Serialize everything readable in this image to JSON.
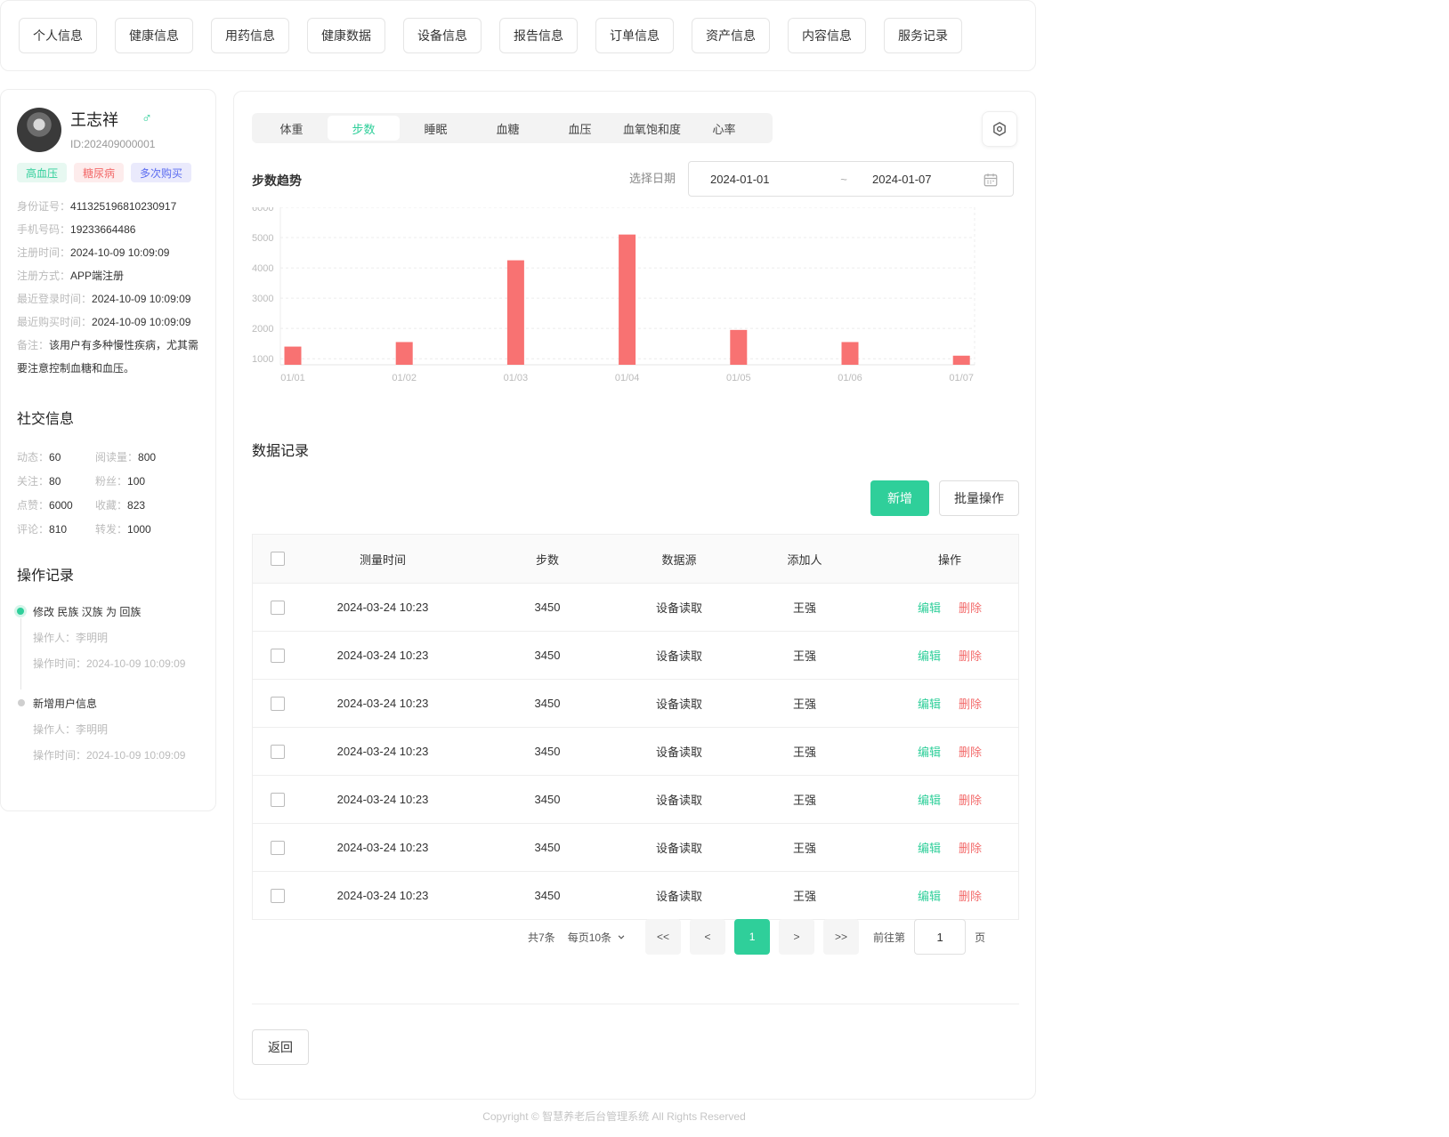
{
  "topnav": [
    "个人信息",
    "健康信息",
    "用药信息",
    "健康数据",
    "设备信息",
    "报告信息",
    "订单信息",
    "资产信息",
    "内容信息",
    "服务记录"
  ],
  "profile": {
    "name": "王志祥",
    "gender_symbol": "♂",
    "id": "ID:202409000001",
    "tags": [
      "高血压",
      "糖尿病",
      "多次购买"
    ],
    "info": [
      {
        "label": "身份证号：",
        "value": "411325196810230917"
      },
      {
        "label": "手机号码：",
        "value": "19233664486"
      },
      {
        "label": "注册时间：",
        "value": "2024-10-09 10:09:09"
      },
      {
        "label": "注册方式：",
        "value": "APP端注册"
      },
      {
        "label": "最近登录时间：",
        "value": "2024-10-09 10:09:09"
      },
      {
        "label": "最近购买时间：",
        "value": "2024-10-09 10:09:09"
      }
    ],
    "note_label": "备注：",
    "note": "该用户有多种慢性疾病，尤其需要注意控制血糖和血压。"
  },
  "social": {
    "title": "社交信息",
    "items": [
      {
        "label": "动态：",
        "value": "60"
      },
      {
        "label": "阅读量：",
        "value": "800"
      },
      {
        "label": "关注：",
        "value": "80"
      },
      {
        "label": "粉丝：",
        "value": "100"
      },
      {
        "label": "点赞：",
        "value": "6000"
      },
      {
        "label": "收藏：",
        "value": "823"
      },
      {
        "label": "评论：",
        "value": "810"
      },
      {
        "label": "转发：",
        "value": "1000"
      }
    ]
  },
  "ops": {
    "title": "操作记录",
    "items": [
      {
        "title": "修改 民族 汉族 为 回族",
        "operator": "操作人：李明明",
        "time": "操作时间：2024-10-09 10:09:09"
      },
      {
        "title": "新增用户信息",
        "operator": "操作人：李明明",
        "time": "操作时间：2024-10-09 10:09:09"
      }
    ]
  },
  "tabs": {
    "items": [
      "体重",
      "步数",
      "睡眠",
      "血糖",
      "血压",
      "血氧饱和度",
      "心率"
    ],
    "active": 1
  },
  "chart_section": {
    "title": "步数趋势",
    "date_label": "选择日期",
    "date_start": "2024-01-01",
    "date_sep": "~",
    "date_end": "2024-01-07"
  },
  "chart_data": {
    "type": "bar",
    "categories": [
      "01/01",
      "01/02",
      "01/03",
      "01/04",
      "01/05",
      "01/06",
      "01/07"
    ],
    "values": [
      1400,
      1550,
      4250,
      5100,
      1950,
      1550,
      1100
    ],
    "ylim": [
      800,
      6000
    ],
    "yticks": [
      1000,
      2000,
      3000,
      4000,
      5000,
      6000
    ],
    "color": "#f87272",
    "grid": true
  },
  "records": {
    "title": "数据记录",
    "add_label": "新增",
    "batch_label": "批量操作",
    "columns": [
      "测量时间",
      "步数",
      "数据源",
      "添加人",
      "操作"
    ],
    "edit_label": "编辑",
    "delete_label": "删除",
    "rows": [
      [
        "2024-03-24 10:23",
        "3450",
        "设备读取",
        "王强"
      ],
      [
        "2024-03-24 10:23",
        "3450",
        "设备读取",
        "王强"
      ],
      [
        "2024-03-24 10:23",
        "3450",
        "设备读取",
        "王强"
      ],
      [
        "2024-03-24 10:23",
        "3450",
        "设备读取",
        "王强"
      ],
      [
        "2024-03-24 10:23",
        "3450",
        "设备读取",
        "王强"
      ],
      [
        "2024-03-24 10:23",
        "3450",
        "设备读取",
        "王强"
      ],
      [
        "2024-03-24 10:23",
        "3450",
        "设备读取",
        "王强"
      ]
    ]
  },
  "pager": {
    "total": "共7条",
    "page_size": "每页10条",
    "first": "<<",
    "prev": "<",
    "current": "1",
    "next": ">",
    "last": ">>",
    "goto_label": "前往第",
    "goto_value": "1",
    "goto_suffix": "页"
  },
  "back_label": "返回",
  "footer": "Copyright © 智慧养老后台管理系统 All Rights Reserved"
}
